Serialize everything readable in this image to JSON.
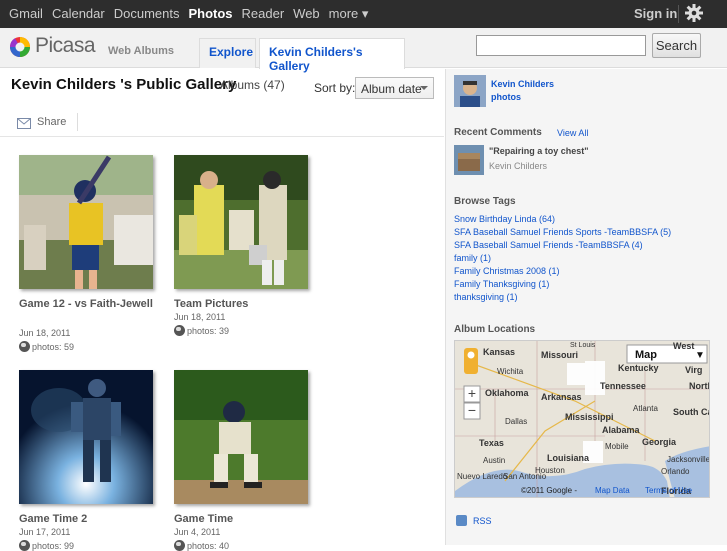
{
  "gbar": {
    "links": [
      "Gmail",
      "Calendar",
      "Documents",
      "Photos",
      "Reader",
      "Web",
      "more ▾"
    ],
    "active": "Photos",
    "signin": "Sign in"
  },
  "header": {
    "logo": "Picasa",
    "logo_sub": "Web Albums",
    "tabs": [
      "Explore",
      "Kevin Childers's Gallery"
    ],
    "search_button": "Search",
    "search_value": ""
  },
  "main": {
    "title": "Kevin Childers 's Public Gallery",
    "albums_count": "Albums (47)",
    "sort_label": "Sort by:",
    "sort_value": "Album date",
    "share_label": "Share",
    "albums": [
      {
        "title": "Game 12 - vs Faith-Jewell",
        "date": "Jun 18, 2011",
        "photos": "photos: 59"
      },
      {
        "title": "Team Pictures",
        "date": "Jun 18, 2011",
        "photos": "photos: 39"
      },
      {
        "title": "Game Time 2",
        "date": "Jun 17, 2011",
        "photos": "photos: 99"
      },
      {
        "title": "Game Time",
        "date": "Jun 4, 2011",
        "photos": "photos: 40"
      }
    ]
  },
  "sidebar": {
    "user_name": "Kevin Childers",
    "user_photos": "photos",
    "recent_comments_heading": "Recent Comments",
    "view_all": "View All",
    "comment_quote": "\"Repairing a toy chest\"",
    "comment_author": "Kevin Childers",
    "browse_tags_heading": "Browse Tags",
    "tags": [
      "Snow Birthday Linda (64)",
      "SFA Baseball Samuel Friends Sports -TeamBBSFA (5)",
      "SFA Baseball Samuel Friends -TeamBBSFA (4)",
      "family (1)",
      "Family Christmas 2008 (1)",
      "Family Thanksgiving (1)",
      "thanksgiving (1)"
    ],
    "album_locations_heading": "Album Locations",
    "map_type": "Map",
    "map_places": [
      "Kansas",
      "Missouri",
      "St Louis",
      "Wichita",
      "Kentucky",
      "Oklahoma",
      "Arkansas",
      "Tennessee",
      "Dallas",
      "Mississippi",
      "Alabama",
      "Atlanta",
      "Georgia",
      "Texas",
      "Louisiana",
      "Austin",
      "Houston",
      "Mobile",
      "South Carolina",
      "North",
      "Virg",
      "West",
      "Orlando",
      "Florida",
      "Jacksonville",
      "Nuevo Laredo",
      "San Antonio"
    ],
    "map_copyright": "©2011 Google -",
    "map_data_link": "Map Data",
    "map_terms": "Terms of Use",
    "rss": "RSS"
  }
}
